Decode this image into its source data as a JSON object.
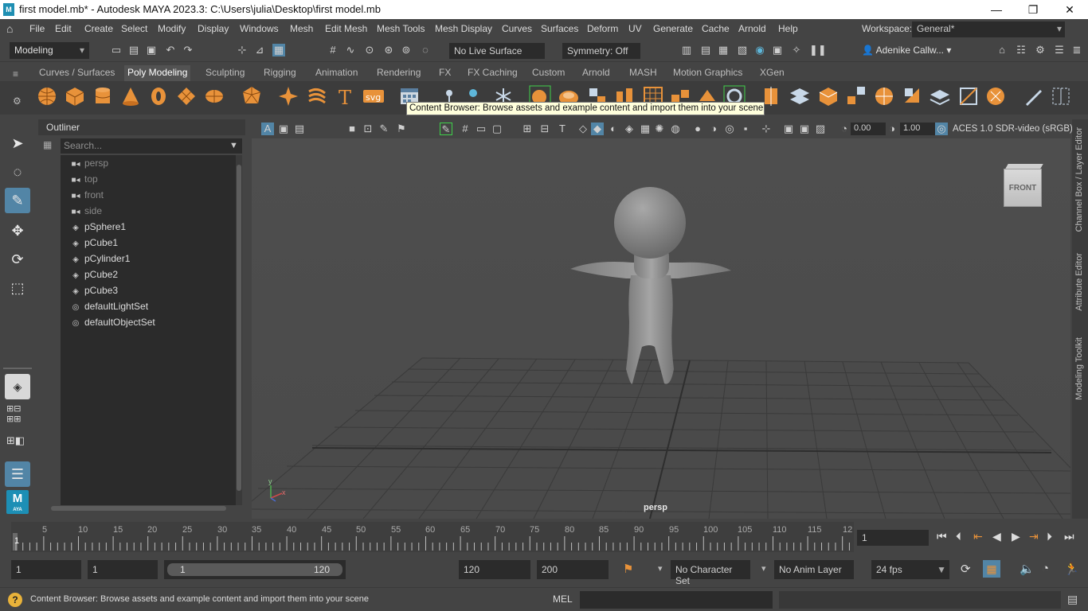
{
  "window": {
    "title": "first model.mb* - Autodesk MAYA 2023.3: C:\\Users\\julia\\Desktop\\first model.mb",
    "app_icon": "M",
    "minimize": "—",
    "maximize": "❐",
    "close": "✕"
  },
  "menubar": {
    "items": [
      "File",
      "Edit",
      "Create",
      "Select",
      "Modify",
      "Display",
      "Windows",
      "Mesh",
      "Edit Mesh",
      "Mesh Tools",
      "Mesh Display",
      "Curves",
      "Surfaces",
      "Deform",
      "UV",
      "Generate",
      "Cache",
      "Arnold",
      "Help"
    ],
    "workspace_label": "Workspace:",
    "workspace_value": "General*"
  },
  "statusline": {
    "mode": "Modeling",
    "live_surface": "No Live Surface",
    "symmetry": "Symmetry: Off",
    "user": "Adenike Callw..."
  },
  "shelf": {
    "tabs": [
      "Curves / Surfaces",
      "Poly Modeling",
      "Sculpting",
      "Rigging",
      "Animation",
      "Rendering",
      "FX",
      "FX Caching",
      "Custom",
      "Arnold",
      "MASH",
      "Motion Graphics",
      "XGen"
    ],
    "active_tab": "Poly Modeling"
  },
  "tooltip": "Content Browser: Browse assets and example content and import them into your scene",
  "outliner": {
    "title": "Outliner",
    "search_placeholder": "Search...",
    "items": [
      {
        "label": "persp",
        "kind": "camera"
      },
      {
        "label": "top",
        "kind": "camera"
      },
      {
        "label": "front",
        "kind": "camera"
      },
      {
        "label": "side",
        "kind": "camera"
      },
      {
        "label": "pSphere1",
        "kind": "mesh"
      },
      {
        "label": "pCube1",
        "kind": "mesh"
      },
      {
        "label": "pCylinder1",
        "kind": "mesh"
      },
      {
        "label": "pCube2",
        "kind": "mesh"
      },
      {
        "label": "pCube3",
        "kind": "mesh"
      },
      {
        "label": "defaultLightSet",
        "kind": "set"
      },
      {
        "label": "defaultObjectSet",
        "kind": "set"
      }
    ]
  },
  "viewport": {
    "camera_label": "persp",
    "viewcube_label": "FRONT",
    "near_value": "0.00",
    "far_value": "1.00",
    "color_space": "ACES 1.0 SDR-video (sRGB)",
    "axis_y": "y",
    "axis_x": "x"
  },
  "right_tabs": [
    "Channel Box / Layer Editor",
    "Attribute Editor",
    "Modeling Toolkit"
  ],
  "timeline": {
    "ticks": [
      "1",
      "5",
      "10",
      "15",
      "20",
      "25",
      "30",
      "35",
      "40",
      "45",
      "50",
      "55",
      "60",
      "65",
      "70",
      "75",
      "80",
      "85",
      "90",
      "95",
      "100",
      "105",
      "110",
      "115",
      "12"
    ],
    "current_frame": "1"
  },
  "range": {
    "start": "1",
    "anim_start": "1",
    "slider_start": "1",
    "slider_end": "120",
    "end": "120",
    "anim_end": "200",
    "character_set": "No Character Set",
    "anim_layer": "No Anim Layer",
    "fps": "24 fps"
  },
  "helpline": {
    "message": "Content Browser: Browse assets and example content and import them into your scene",
    "script_lang": "MEL"
  },
  "colors": {
    "accent": "#5285a6",
    "shelf_orange": "#e8923a",
    "background": "#444444"
  }
}
